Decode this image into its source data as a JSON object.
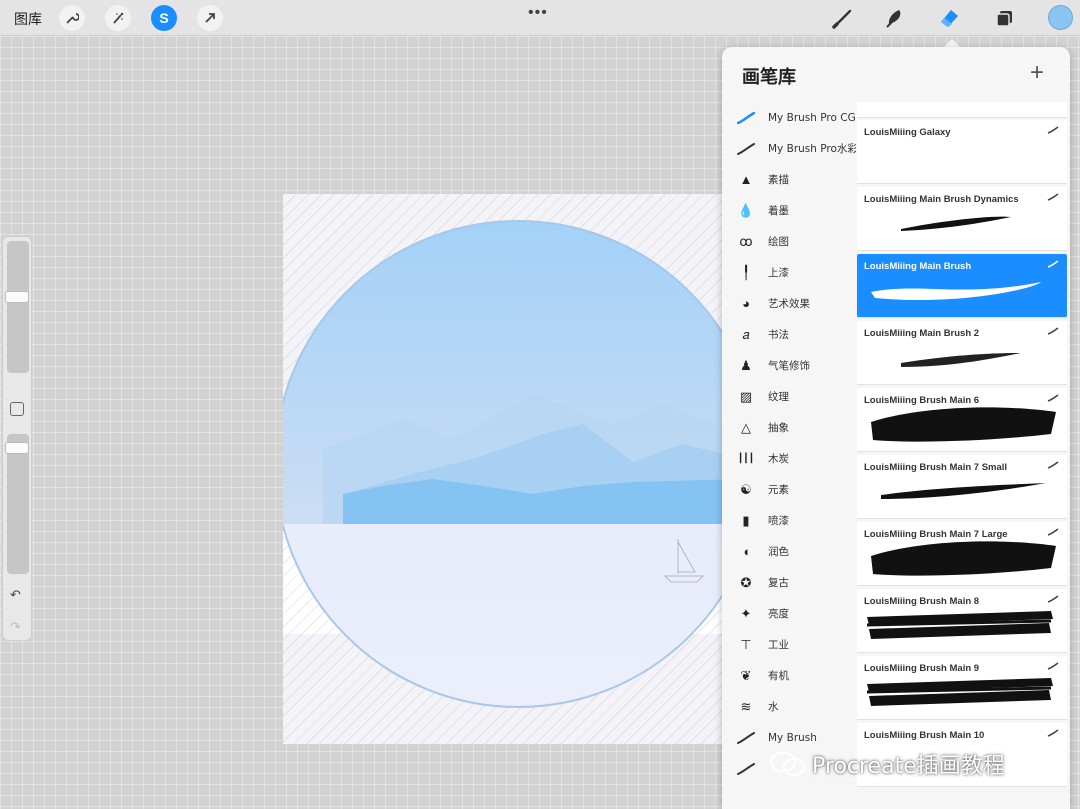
{
  "topbar": {
    "gallery_label": "图库",
    "left_tools": [
      {
        "name": "actions-wrench-icon"
      },
      {
        "name": "adjustments-wand-icon"
      },
      {
        "name": "selection-s-icon",
        "label": "S",
        "active": true
      },
      {
        "name": "transform-arrow-icon"
      }
    ],
    "more": "•••",
    "right_tools": [
      "brush-icon",
      "smudge-icon",
      "eraser-icon",
      "layers-icon"
    ],
    "current_color": "#8cc4f0"
  },
  "sidebar": {
    "size_level": 0.2,
    "opacity_level": 0.05
  },
  "panel": {
    "title": "画笔库",
    "add": "+",
    "sets": [
      {
        "icon": "stroke-blue-icon",
        "label": "My Brush Pro CG"
      },
      {
        "icon": "stroke-icon",
        "label": "My Brush Pro水彩"
      },
      {
        "icon": "sketch-pencil-icon",
        "label": "素描"
      },
      {
        "icon": "ink-drop-icon",
        "label": "着墨"
      },
      {
        "icon": "drawing-curl-icon",
        "label": "绘图"
      },
      {
        "icon": "paint-brush-icon",
        "label": "上漆"
      },
      {
        "icon": "palette-icon",
        "label": "艺术效果"
      },
      {
        "icon": "calligraphy-icon",
        "label": "书法"
      },
      {
        "icon": "airbrush-icon",
        "label": "气笔修饰"
      },
      {
        "icon": "texture-icon",
        "label": "纹理"
      },
      {
        "icon": "abstract-triangle-icon",
        "label": "抽象"
      },
      {
        "icon": "charcoal-icon",
        "label": "木炭"
      },
      {
        "icon": "elements-yin-yang-icon",
        "label": "元素"
      },
      {
        "icon": "spray-can-icon",
        "label": "喷漆"
      },
      {
        "icon": "touchup-icon",
        "label": "润色"
      },
      {
        "icon": "vintage-star-icon",
        "label": "复古"
      },
      {
        "icon": "luminance-sparkle-icon",
        "label": "亮度"
      },
      {
        "icon": "industrial-anvil-icon",
        "label": "工业"
      },
      {
        "icon": "organic-leaf-icon",
        "label": "有机"
      },
      {
        "icon": "water-waves-icon",
        "label": "水"
      },
      {
        "icon": "stroke-icon",
        "label": "My Brush"
      },
      {
        "icon": "stroke-icon",
        "label": ""
      }
    ],
    "brushes": [
      {
        "name": "",
        "style": "speckle"
      },
      {
        "name": "LouisMiiing Galaxy",
        "style": "none"
      },
      {
        "name": "LouisMiiing Main Brush Dynamics",
        "style": "taper"
      },
      {
        "name": "LouisMiiing Main Brush",
        "style": "wave",
        "selected": true
      },
      {
        "name": "LouisMiiing Main Brush 2",
        "style": "rough-thin"
      },
      {
        "name": "LouisMiiing Brush Main 6",
        "style": "heavy"
      },
      {
        "name": "LouisMiiing Brush Main 7 Small",
        "style": "taper-long"
      },
      {
        "name": "LouisMiiing Brush Main 7 Large",
        "style": "heavy"
      },
      {
        "name": "LouisMiiing Brush Main 8",
        "style": "dry"
      },
      {
        "name": "LouisMiiing Brush Main 9",
        "style": "dry"
      },
      {
        "name": "LouisMiiing Brush Main 10",
        "style": "none"
      }
    ]
  },
  "watermark": {
    "text": "Procreate插画教程"
  }
}
